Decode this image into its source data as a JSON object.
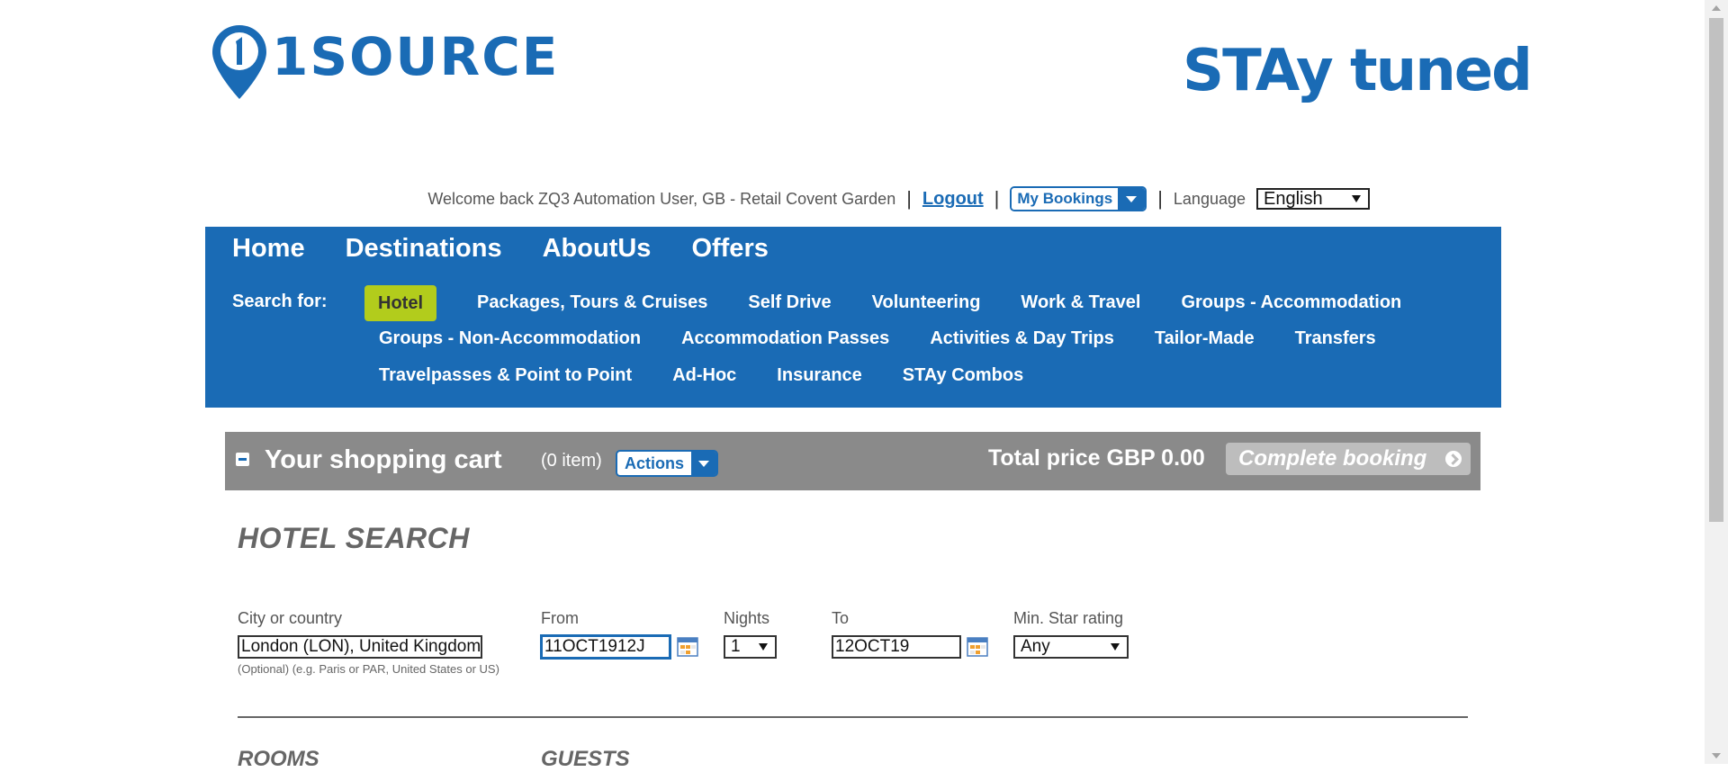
{
  "header": {
    "left_logo_text": "1SOURCE",
    "right_logo_text": "STAy tuned"
  },
  "userbar": {
    "welcome": "Welcome back ZQ3 Automation User, GB - Retail Covent Garden",
    "logout": "Logout",
    "my_bookings": "My Bookings",
    "language_label": "Language",
    "language_value": "English"
  },
  "nav": {
    "main": [
      "Home",
      "Destinations",
      "AboutUs",
      "Offers"
    ],
    "search_for": "Search for:",
    "row1": [
      "Hotel",
      "Packages, Tours & Cruises",
      "Self Drive",
      "Volunteering",
      "Work & Travel",
      "Groups - Accommodation"
    ],
    "row2": [
      "Groups - Non-Accommodation",
      "Accommodation Passes",
      "Activities & Day Trips",
      "Tailor-Made",
      "Transfers"
    ],
    "row3": [
      "Travelpasses & Point to Point",
      "Ad-Hoc",
      "Insurance",
      "STAy Combos"
    ]
  },
  "cart": {
    "title": "Your shopping cart",
    "count": "(0 item)",
    "actions": "Actions",
    "total": "Total price GBP 0.00",
    "complete": "Complete booking"
  },
  "search": {
    "title": "HOTEL SEARCH",
    "city_label": "City or country",
    "city_value": "London (LON), United Kingdom",
    "city_hint": "(Optional) (e.g. Paris or PAR, United States or US)",
    "from_label": "From",
    "from_value": "11OCT1912J",
    "nights_label": "Nights",
    "nights_value": "1",
    "to_label": "To",
    "to_value": "12OCT19",
    "star_label": "Min. Star rating",
    "star_value": "Any",
    "rooms_title": "ROOMS",
    "guests_title": "GUESTS"
  },
  "colors": {
    "brand_blue": "#1a6bb5",
    "active_green": "#b2cc1c",
    "cart_grey": "#8a8a8a"
  }
}
